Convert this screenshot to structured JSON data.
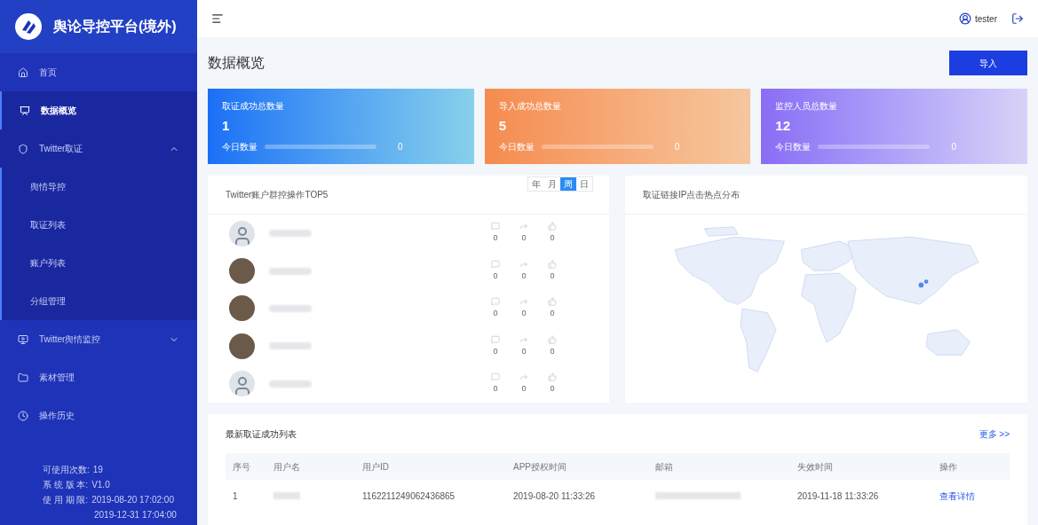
{
  "sidebar": {
    "title": "舆论导控平台(境外)",
    "items": [
      {
        "label": "首页",
        "selected": false
      },
      {
        "label": "数据概览",
        "selected": true
      },
      {
        "label": "Twitter取证",
        "expanded": true,
        "children": [
          {
            "label": "舆情导控",
            "selected": false
          },
          {
            "label": "取证列表",
            "selected": false
          },
          {
            "label": "账户列表",
            "selected": false
          },
          {
            "label": "分组管理",
            "selected": false
          }
        ]
      },
      {
        "label": "Twitter舆情监控",
        "expanded": false
      },
      {
        "label": "素材管理",
        "selected": false
      },
      {
        "label": "操作历史",
        "selected": false
      }
    ],
    "footer": [
      {
        "label": "可使用次数:",
        "value": "19"
      },
      {
        "label": "系 统 版 本:",
        "value": "V1.0"
      },
      {
        "label": "使 用 期 限:",
        "value": "2019-08-20 17:02:00"
      },
      {
        "value": "2019-12-31 17:04:00"
      }
    ]
  },
  "header": {
    "user": "tester"
  },
  "page": {
    "title": "数据概览",
    "import_button": "导入"
  },
  "stat_cards": [
    {
      "title": "取证成功总数量",
      "value": "1",
      "today_label": "今日数量",
      "today_value": "0",
      "level": 0,
      "kind": "blue"
    },
    {
      "title": "导入成功总数量",
      "value": "5",
      "today_label": "今日数量",
      "today_value": "0",
      "level": 0,
      "kind": "orange"
    },
    {
      "title": "监控人员总数量",
      "value": "12",
      "today_label": "今日数量",
      "today_value": "0",
      "level": 0,
      "kind": "purple"
    }
  ],
  "top5": {
    "title": "Twitter账户群控操作TOP5",
    "periods": [
      {
        "label": "年",
        "selected": false
      },
      {
        "label": "月",
        "selected": false
      },
      {
        "label": "周",
        "selected": true
      },
      {
        "label": "日",
        "selected": false
      }
    ],
    "rows": [
      {
        "kind": "default",
        "comments": "0",
        "retweets": "0",
        "likes": "0"
      },
      {
        "kind": "photo",
        "comments": "0",
        "retweets": "0",
        "likes": "0"
      },
      {
        "kind": "photo",
        "comments": "0",
        "retweets": "0",
        "likes": "0"
      },
      {
        "kind": "photo",
        "comments": "0",
        "retweets": "0",
        "likes": "0"
      },
      {
        "kind": "default",
        "comments": "0",
        "retweets": "0",
        "likes": "0"
      }
    ]
  },
  "map": {
    "title": "取证链接IP点击热点分布"
  },
  "table": {
    "title": "最新取证成功列表",
    "more": "更多 >>",
    "columns": [
      "序号",
      "用户名",
      "用户ID",
      "APP授权时间",
      "邮箱",
      "失效时间",
      "操作"
    ],
    "rows": [
      {
        "index": "1",
        "user_id": "1162211249062436865",
        "auth_time": "2019-08-20 11:33:26",
        "expire_time": "2019-11-18 11:33:26",
        "action": "查看详情"
      }
    ]
  }
}
